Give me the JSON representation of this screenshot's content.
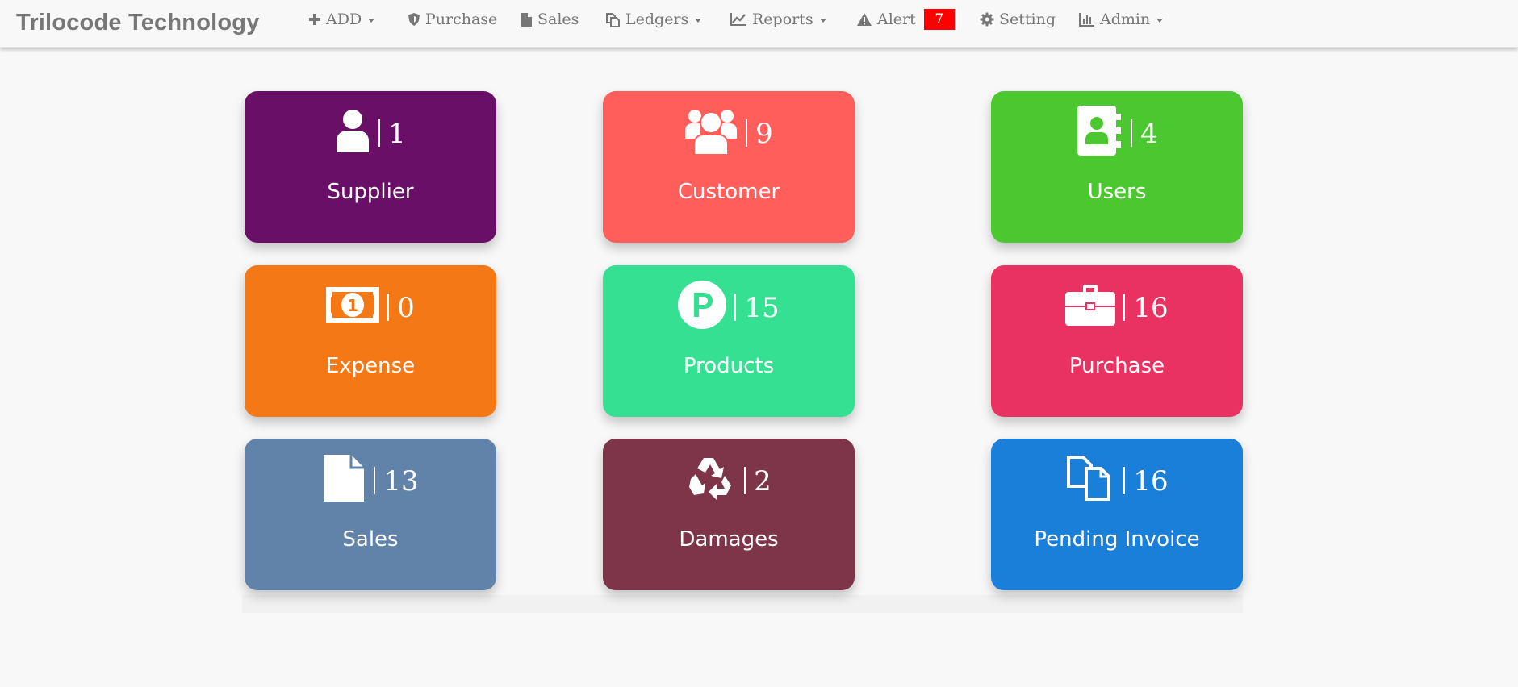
{
  "brand": "Trilocode Technology",
  "nav": {
    "add": "ADD",
    "purchase": "Purchase",
    "sales": "Sales",
    "ledgers": "Ledgers",
    "reports": "Reports",
    "alert": "Alert",
    "alert_count": "7",
    "setting": "Setting",
    "admin": "Admin"
  },
  "cards": [
    {
      "label": "Supplier",
      "count": "1",
      "color": "#6a0f68",
      "icon": "user-icon"
    },
    {
      "label": "Customer",
      "count": "9",
      "color": "#ff5e5b",
      "icon": "users-icon"
    },
    {
      "label": "Users",
      "count": "4",
      "color": "#4bc82f",
      "icon": "address-book-icon"
    },
    {
      "label": "Expense",
      "count": "0",
      "color": "#f47816",
      "icon": "money-bill-icon"
    },
    {
      "label": "Products",
      "count": "15",
      "color": "#36e093",
      "icon": "product-p-icon"
    },
    {
      "label": "Purchase",
      "count": "16",
      "color": "#e93261",
      "icon": "briefcase-icon"
    },
    {
      "label": "Sales",
      "count": "13",
      "color": "#6183aa",
      "icon": "file-icon"
    },
    {
      "label": "Damages",
      "count": "2",
      "color": "#7e3549",
      "icon": "recycle-icon"
    },
    {
      "label": "Pending Invoice",
      "count": "16",
      "color": "#1a7fd9",
      "icon": "copy-icon"
    }
  ]
}
